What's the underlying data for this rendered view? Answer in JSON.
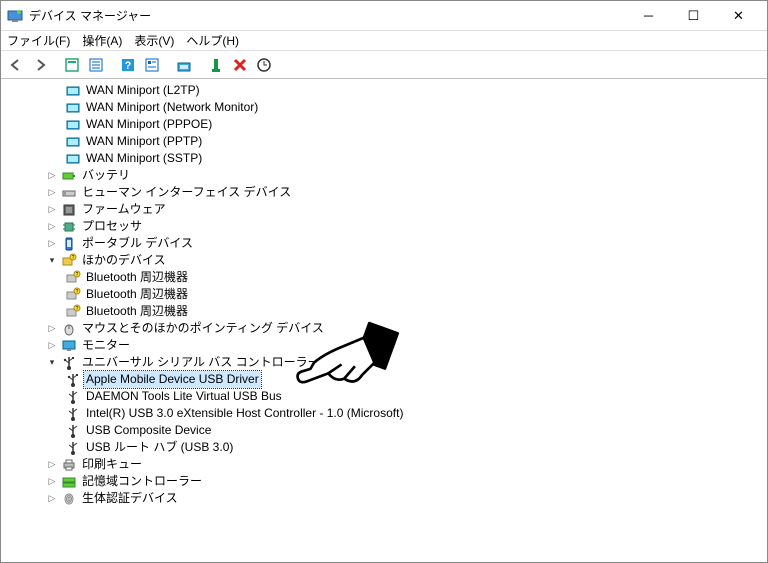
{
  "window": {
    "title": "デバイス マネージャー"
  },
  "menu": {
    "file": "ファイル(F)",
    "action": "操作(A)",
    "view": "表示(V)",
    "help": "ヘルプ(H)"
  },
  "tree": {
    "wan_l2tp": "WAN Miniport (L2TP)",
    "wan_netmon": "WAN Miniport (Network Monitor)",
    "wan_pppoe": "WAN Miniport (PPPOE)",
    "wan_pptp": "WAN Miniport (PPTP)",
    "wan_sstp": "WAN Miniport (SSTP)",
    "battery": "バッテリ",
    "hid": "ヒューマン インターフェイス デバイス",
    "firmware": "ファームウェア",
    "processor": "プロセッサ",
    "portable": "ポータブル デバイス",
    "other": "ほかのデバイス",
    "bt1": "Bluetooth 周辺機器",
    "bt2": "Bluetooth 周辺機器",
    "bt3": "Bluetooth 周辺機器",
    "mouse": "マウスとそのほかのポインティング デバイス",
    "monitor": "モニター",
    "usb_ctrl": "ユニバーサル シリアル バス コントローラー",
    "apple_usb": "Apple Mobile Device USB Driver",
    "daemon": "DAEMON Tools Lite Virtual USB Bus",
    "intel_usb": "Intel(R) USB 3.0 eXtensible Host Controller - 1.0 (Microsoft)",
    "usb_comp": "USB Composite Device",
    "usb_root": "USB ルート ハブ (USB 3.0)",
    "print_queue": "印刷キュー",
    "storage_ctrl": "記憶域コントローラー",
    "biometric": "生体認証デバイス"
  }
}
